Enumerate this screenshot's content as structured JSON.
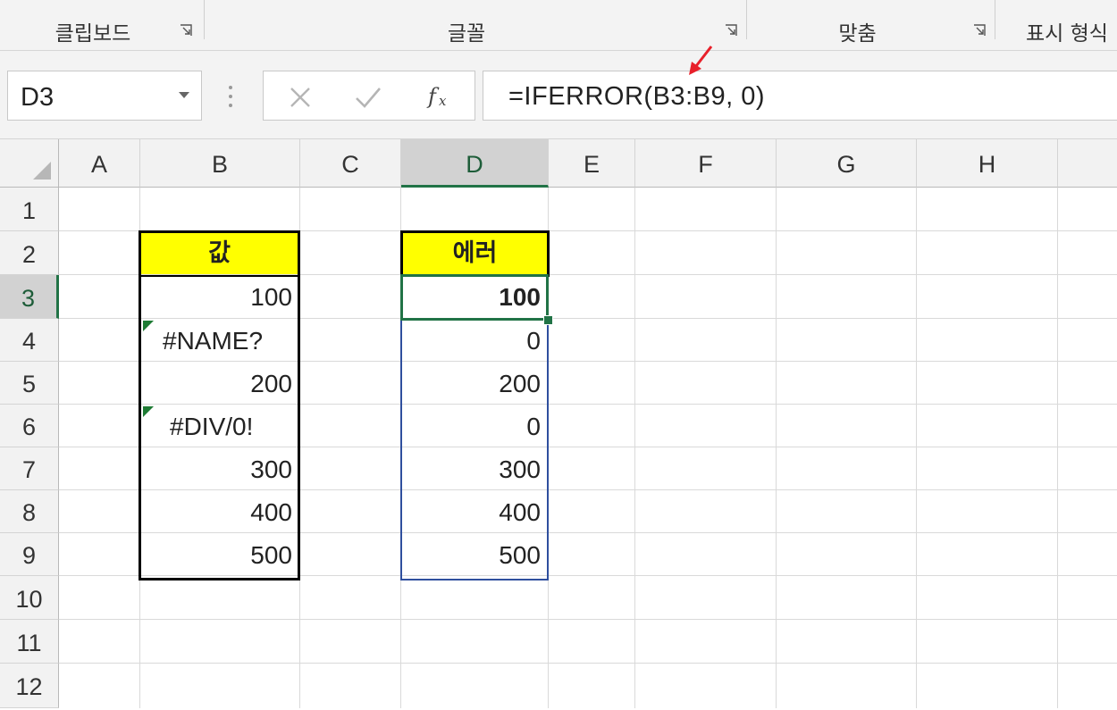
{
  "ribbon": {
    "groups": [
      {
        "label": "클립보드"
      },
      {
        "label": "글꼴"
      },
      {
        "label": "맞춤"
      },
      {
        "label": "표시 형식"
      }
    ]
  },
  "formula_bar": {
    "name_box": "D3",
    "formula": "=IFERROR(B3:B9, 0)",
    "buttons": [
      "cancel-icon",
      "enter-icon",
      "fx-icon"
    ],
    "arrow_color": "#e8202a"
  },
  "sheet": {
    "columns": [
      "A",
      "B",
      "C",
      "D",
      "E",
      "F",
      "G",
      "H"
    ],
    "rows": [
      "1",
      "2",
      "3",
      "4",
      "5",
      "6",
      "7",
      "8",
      "9",
      "10",
      "11",
      "12"
    ],
    "selected_cell": "D3",
    "header_fill": "#ffff00",
    "accent": "#217346",
    "b_header": "값",
    "d_header": "에러",
    "b_values": [
      "100",
      "#NAME?",
      "200",
      "#DIV/0!",
      "300",
      "400",
      "500"
    ],
    "d_values": [
      "100",
      "0",
      "200",
      "0",
      "300",
      "400",
      "500"
    ]
  }
}
